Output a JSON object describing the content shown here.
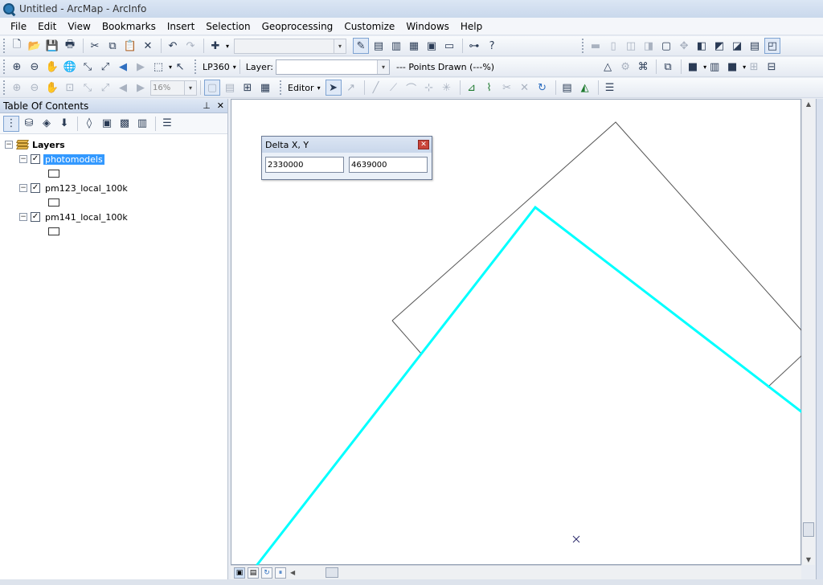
{
  "window": {
    "title": "Untitled - ArcMap - ArcInfo"
  },
  "menu": [
    "File",
    "Edit",
    "View",
    "Bookmarks",
    "Insert",
    "Selection",
    "Geoprocessing",
    "Customize",
    "Windows",
    "Help"
  ],
  "toolbar": {
    "lp360_label": "LP360",
    "layer_label": "Layer:",
    "layer_value": "",
    "points_drawn": "--- Points Drawn (---%)",
    "zoom_value": "16%",
    "editor_label": "Editor"
  },
  "toc": {
    "title": "Table Of Contents",
    "root": "Layers",
    "layers": [
      {
        "name": "photomodels",
        "checked": true,
        "selected": true
      },
      {
        "name": "pm123_local_100k",
        "checked": true,
        "selected": false
      },
      {
        "name": "pm141_local_100k",
        "checked": true,
        "selected": false
      }
    ]
  },
  "dialog": {
    "title": "Delta X, Y",
    "x_value": "2330000",
    "y_value": "4639000"
  },
  "colors": {
    "highlight_line": "#00ffff",
    "outline_line": "#555555",
    "marker": "#2d2a6b"
  }
}
